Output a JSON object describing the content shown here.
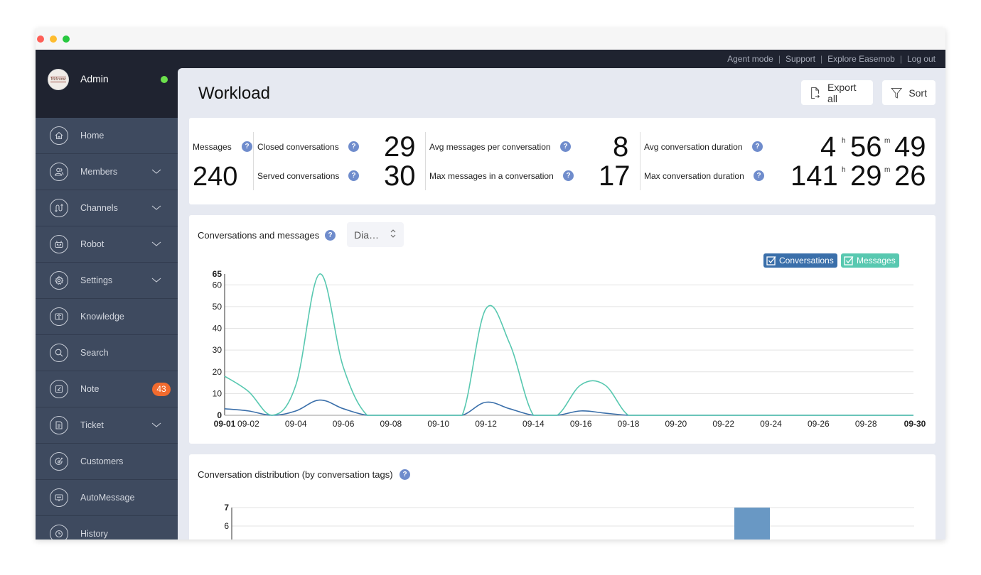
{
  "window": {
    "title": ""
  },
  "topnav": {
    "links": [
      "Agent mode",
      "Support",
      "Explore Easemob",
      "Log out"
    ]
  },
  "profile": {
    "name": "Admin",
    "avatar_text": "Welcome",
    "status": "online",
    "status_color": "#6ce04c"
  },
  "sidebar": {
    "items": [
      {
        "label": "Home",
        "icon": "home-icon",
        "expandable": false
      },
      {
        "label": "Members",
        "icon": "members-icon",
        "expandable": true
      },
      {
        "label": "Channels",
        "icon": "channels-icon",
        "expandable": true
      },
      {
        "label": "Robot",
        "icon": "robot-icon",
        "expandable": true
      },
      {
        "label": "Settings",
        "icon": "gear-icon",
        "expandable": true
      },
      {
        "label": "Knowledge",
        "icon": "book-icon",
        "expandable": false
      },
      {
        "label": "Search",
        "icon": "search-icon",
        "expandable": false
      },
      {
        "label": "Note",
        "icon": "note-icon",
        "expandable": false,
        "badge": "43"
      },
      {
        "label": "Ticket",
        "icon": "ticket-icon",
        "expandable": true
      },
      {
        "label": "Customers",
        "icon": "customers-icon",
        "expandable": false
      },
      {
        "label": "AutoMessage",
        "icon": "automessage-icon",
        "expandable": false
      },
      {
        "label": "History",
        "icon": "clock-icon",
        "expandable": false
      }
    ]
  },
  "header": {
    "title": "Workload",
    "export_label": "Export all",
    "sort_label": "Sort"
  },
  "stats": {
    "messages": {
      "label": "Messages",
      "value": "240"
    },
    "closed_conversations": {
      "label": "Closed conversations",
      "value": "29"
    },
    "served_conversations": {
      "label": "Served conversations",
      "value": "30"
    },
    "avg_messages": {
      "label": "Avg messages per conversation",
      "value": "8"
    },
    "max_messages": {
      "label": "Max messages in a conversation",
      "value": "17"
    },
    "avg_duration": {
      "label": "Avg conversation duration",
      "h": "4",
      "m": "56",
      "s": "49",
      "h_unit": "h",
      "m_unit": "m"
    },
    "max_duration": {
      "label": "Max conversation duration",
      "h": "141",
      "m": "29",
      "s": "26",
      "h_unit": "h",
      "m_unit": "m"
    },
    "help_glyph": "?"
  },
  "conversations_chart": {
    "title": "Conversations and messages",
    "select_value": "Dia…",
    "legend": [
      {
        "name": "Conversations",
        "color": "#3a6faa",
        "checked": true
      },
      {
        "name": "Messages",
        "color": "#58c8b0",
        "checked": true
      }
    ]
  },
  "distribution_chart": {
    "title": "Conversation distribution (by conversation tags)"
  },
  "chart_data": [
    {
      "type": "line",
      "title": "Conversations and messages",
      "xlabel": "",
      "ylabel": "",
      "x": [
        "09-01",
        "09-02",
        "09-03",
        "09-04",
        "09-05",
        "09-06",
        "09-07",
        "09-08",
        "09-09",
        "09-10",
        "09-11",
        "09-12",
        "09-13",
        "09-14",
        "09-15",
        "09-16",
        "09-17",
        "09-18",
        "09-19",
        "09-20",
        "09-21",
        "09-22",
        "09-23",
        "09-24",
        "09-25",
        "09-26",
        "09-27",
        "09-28",
        "09-29",
        "09-30"
      ],
      "x_tick_labels": [
        "09-01",
        "09-02",
        "09-04",
        "09-06",
        "09-08",
        "09-10",
        "09-12",
        "09-14",
        "09-16",
        "09-18",
        "09-20",
        "09-22",
        "09-24",
        "09-26",
        "09-28",
        "09-30"
      ],
      "ylim": [
        0,
        65
      ],
      "y_ticks": [
        0,
        10,
        20,
        30,
        40,
        50,
        60,
        65
      ],
      "grid": true,
      "legend_position": "top-right",
      "series": [
        {
          "name": "Conversations",
          "color": "#3a6faa",
          "values": [
            3,
            2,
            0,
            2,
            7,
            3,
            0,
            0,
            0,
            0,
            0,
            6,
            3,
            0,
            0,
            2,
            1,
            0,
            0,
            0,
            0,
            0,
            0,
            0,
            0,
            0,
            0,
            0,
            0,
            0
          ]
        },
        {
          "name": "Messages",
          "color": "#58c8b0",
          "values": [
            18,
            11,
            0,
            14,
            65,
            22,
            0,
            0,
            0,
            0,
            0,
            49,
            33,
            0,
            0,
            14,
            14,
            0,
            0,
            0,
            0,
            0,
            0,
            0,
            0,
            0,
            0,
            0,
            0,
            0
          ]
        }
      ]
    },
    {
      "type": "bar",
      "title": "Conversation distribution (by conversation tags)",
      "ylim": [
        0,
        7
      ],
      "y_ticks_visible": [
        6,
        7
      ],
      "categories": [],
      "values": [
        7
      ],
      "color": "#6998c4",
      "grid": true
    }
  ]
}
